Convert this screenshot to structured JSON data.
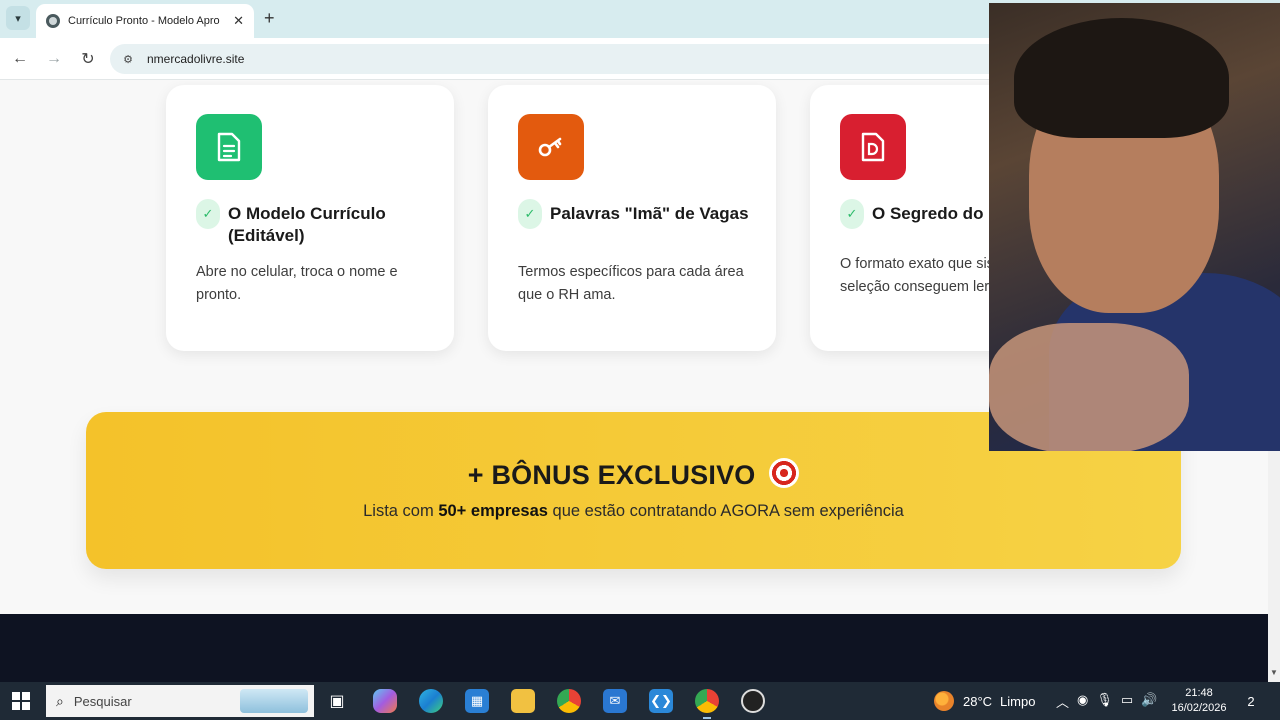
{
  "browser": {
    "tab_title": "Currículo Pronto - Modelo Apro",
    "tab_close": "✕",
    "new_tab": "+",
    "url": "nmercadolivre.site"
  },
  "cards": [
    {
      "icon": "document-icon",
      "title": "O Modelo Currículo (Editável)",
      "description": "Abre no celular, troca o nome e pronto.",
      "color": "#1fbf72"
    },
    {
      "icon": "key-icon",
      "title": "Palavras \"Imã\" de Vagas",
      "description": "Termos específicos para cada área que o RH ama.",
      "color": "#e35a0e"
    },
    {
      "icon": "pdf-file-icon",
      "title": "O Segredo do",
      "description": "O formato exato que sistemas de seleção conseguem ler (e apr",
      "color": "#d81f30"
    }
  ],
  "bonus": {
    "title": "+ BÔNUS EXCLUSIVO",
    "subtitle_before": "Lista com ",
    "subtitle_bold": "50+ empresas",
    "subtitle_after": " que estão contratando AGORA sem experiência",
    "color": "#f4c22a"
  },
  "taskbar": {
    "search_placeholder": "Pesquisar",
    "weather_temp": "28°C",
    "weather_desc": "Limpo",
    "time": "21:48",
    "date": "16/02/2026",
    "notifications": "2"
  }
}
